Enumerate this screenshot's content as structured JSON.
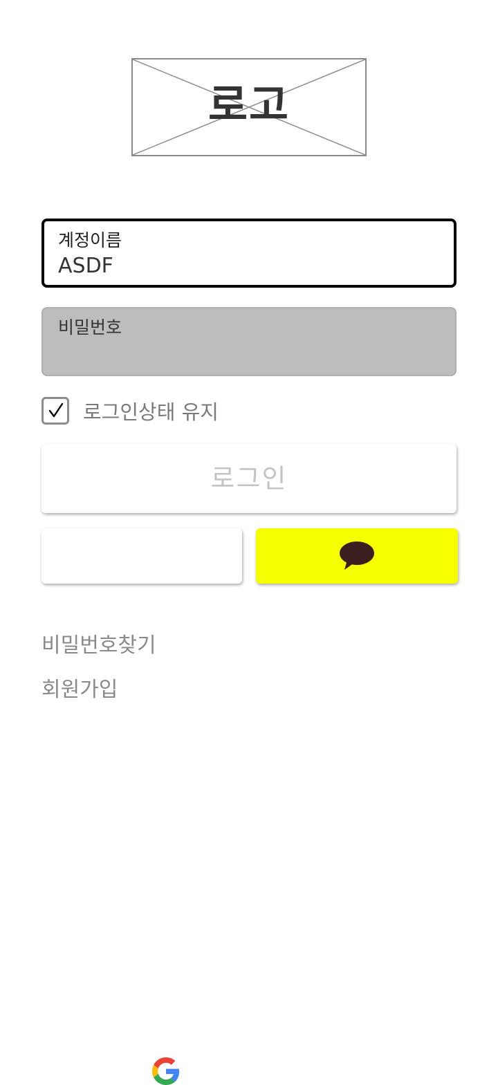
{
  "logo": {
    "text": "로고"
  },
  "username": {
    "label": "계정이름",
    "value": "ASDF"
  },
  "password": {
    "label": "비밀번호",
    "value": ""
  },
  "keep_login": {
    "label": "로그인상태 유지",
    "checked": true
  },
  "login_button": {
    "label": "로그인"
  },
  "social": {
    "google_icon": "google-logo-icon",
    "kakao_icon": "kakao-speech-bubble-icon",
    "kakao_color": "#f6ff00",
    "google_colors": [
      "#4285F4",
      "#EA4335",
      "#FBBC05",
      "#34A853"
    ]
  },
  "links": {
    "find_password": "비밀번호찾기",
    "signup": "회원가입"
  },
  "colors": {
    "field_focus_border": "#000000",
    "field_disabled_bg": "#bdbdbd",
    "muted_text": "#8a8a8a"
  }
}
